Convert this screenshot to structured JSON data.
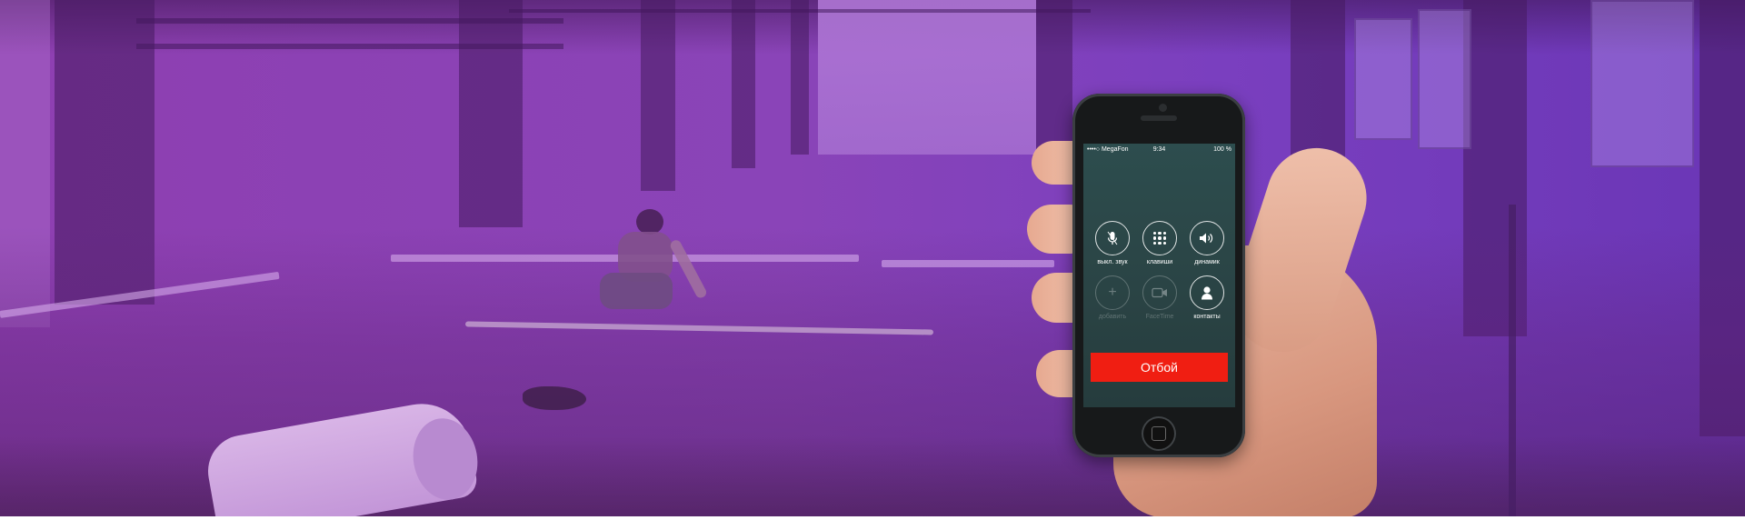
{
  "phone": {
    "status_bar": {
      "carrier": "••••○ MegaFon",
      "time": "9:34",
      "battery": "100 %"
    },
    "keys": [
      {
        "label": "выкл. звук",
        "icon": "microphone-mute-icon"
      },
      {
        "label": "клавиши",
        "icon": "keypad-icon"
      },
      {
        "label": "динамик",
        "icon": "speaker-icon"
      },
      {
        "label": "добавить",
        "icon": "plus-icon"
      },
      {
        "label": "FaceTime",
        "icon": "facetime-icon"
      },
      {
        "label": "контакты",
        "icon": "contacts-icon"
      }
    ],
    "end_call_label": "Отбой"
  },
  "colors": {
    "overlay_purple": "#8e3fb1",
    "screen_bg": "#2d4d4e",
    "end_call_red": "#f01e12"
  }
}
